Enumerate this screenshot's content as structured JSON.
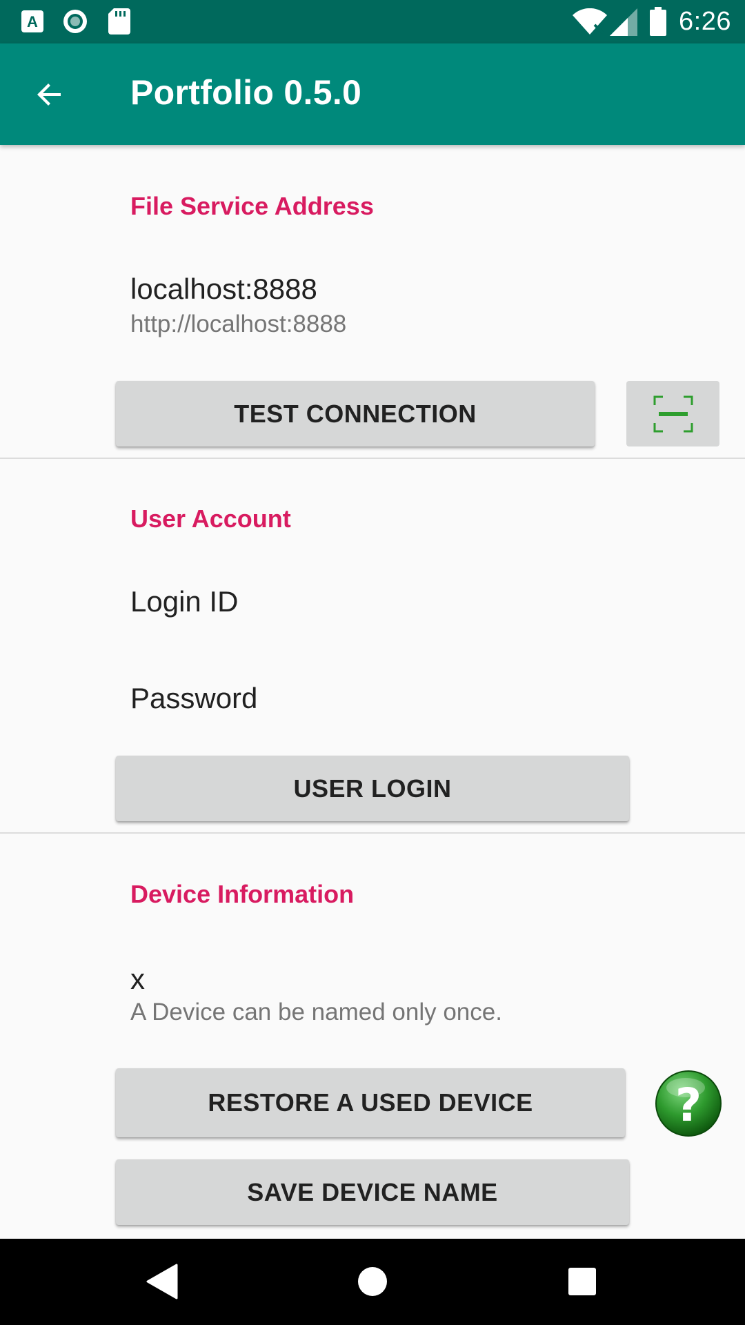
{
  "status_bar": {
    "time": "6:26",
    "left_icons": [
      "font-a-icon",
      "record-icon",
      "sd-card-icon"
    ],
    "right_icons": [
      "wifi-off-icon",
      "signal-icon",
      "battery-icon"
    ]
  },
  "app_bar": {
    "title": "Portfolio 0.5.0",
    "back_icon": "arrow-left-icon"
  },
  "file_service": {
    "header": "File Service Address",
    "address_title": "localhost:8888",
    "address_summary": "http://localhost:8888",
    "test_button": "TEST CONNECTION",
    "scan_icon": "qr-scan-icon"
  },
  "user_account": {
    "header": "User Account",
    "login_id": "Login ID",
    "password": "Password",
    "login_button": "USER LOGIN"
  },
  "device_info": {
    "header": "Device Information",
    "device_name": "x",
    "device_summary": "A Device can be named only once.",
    "restore_button": "RESTORE A USED DEVICE",
    "save_button": "SAVE DEVICE NAME",
    "help_icon": "help-icon"
  },
  "nav_bar": {
    "icons": [
      "back-triangle-icon",
      "home-circle-icon",
      "recents-square-icon"
    ]
  },
  "colors": {
    "status_bar": "#00695c",
    "app_bar": "#00897b",
    "section_accent": "#d81b60",
    "button_bg": "#d6d7d7",
    "scan_green": "#2e9e2e",
    "help_green": "#2e8b2e"
  }
}
